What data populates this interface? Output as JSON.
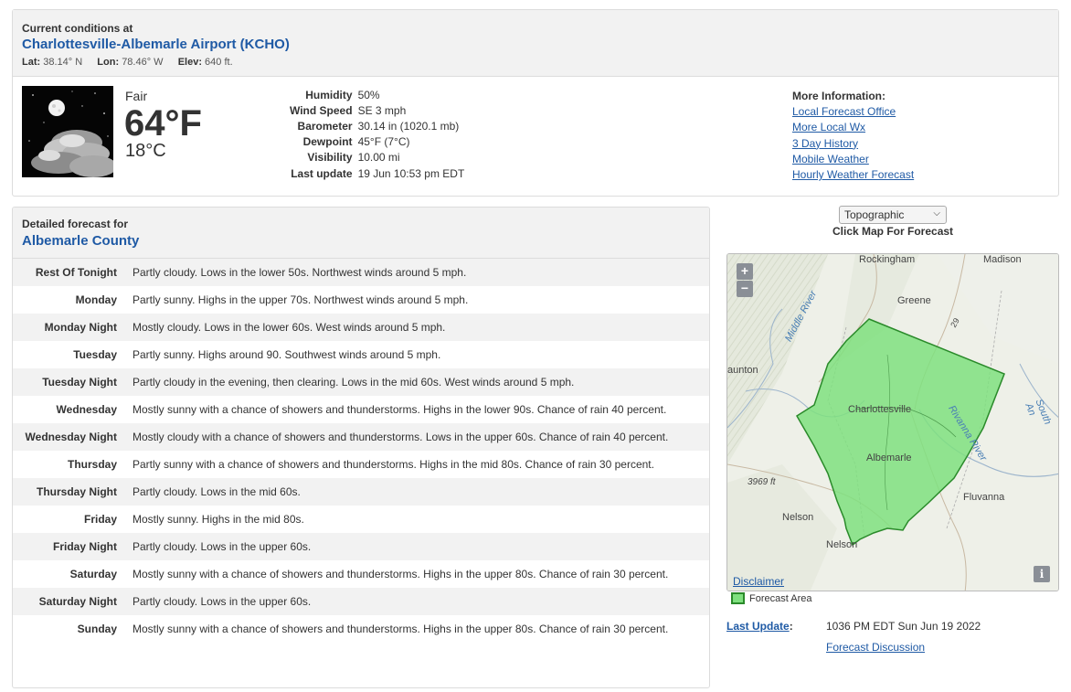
{
  "current": {
    "heading": "Current conditions at",
    "station": "Charlottesville-Albemarle Airport (KCHO)",
    "lat_label": "Lat:",
    "lat": "38.14° N",
    "lon_label": "Lon:",
    "lon": "78.46° W",
    "elev_label": "Elev:",
    "elev": "640 ft.",
    "condition": "Fair",
    "temp_f": "64°F",
    "temp_c": "18°C",
    "icon": "night-fair-moon-clouds-icon",
    "details": [
      {
        "label": "Humidity",
        "value": "50%"
      },
      {
        "label": "Wind Speed",
        "value": "SE 3 mph"
      },
      {
        "label": "Barometer",
        "value": "30.14 in (1020.1 mb)"
      },
      {
        "label": "Dewpoint",
        "value": "45°F (7°C)"
      },
      {
        "label": "Visibility",
        "value": "10.00 mi"
      },
      {
        "label": "Last update",
        "value": "19 Jun 10:53 pm EDT"
      }
    ],
    "more_info": {
      "title": "More Information:",
      "links": [
        "Local Forecast Office",
        "More Local Wx",
        "3 Day History",
        "Mobile Weather",
        "Hourly Weather Forecast"
      ]
    }
  },
  "forecast": {
    "heading": "Detailed forecast for",
    "area": "Albemarle County",
    "periods": [
      {
        "name": "Rest Of Tonight",
        "text": "Partly cloudy. Lows in the lower 50s. Northwest winds around 5 mph."
      },
      {
        "name": "Monday",
        "text": "Partly sunny. Highs in the upper 70s. Northwest winds around 5 mph."
      },
      {
        "name": "Monday Night",
        "text": "Mostly cloudy. Lows in the lower 60s. West winds around 5 mph."
      },
      {
        "name": "Tuesday",
        "text": "Partly sunny. Highs around 90. Southwest winds around 5 mph."
      },
      {
        "name": "Tuesday Night",
        "text": "Partly cloudy in the evening, then clearing. Lows in the mid 60s. West winds around 5 mph."
      },
      {
        "name": "Wednesday",
        "text": "Mostly sunny with a chance of showers and thunderstorms. Highs in the lower 90s. Chance of rain 40 percent."
      },
      {
        "name": "Wednesday Night",
        "text": "Mostly cloudy with a chance of showers and thunderstorms. Lows in the upper 60s. Chance of rain 40 percent."
      },
      {
        "name": "Thursday",
        "text": "Partly sunny with a chance of showers and thunderstorms. Highs in the mid 80s. Chance of rain 30 percent."
      },
      {
        "name": "Thursday Night",
        "text": "Partly cloudy. Lows in the mid 60s."
      },
      {
        "name": "Friday",
        "text": "Mostly sunny. Highs in the mid 80s."
      },
      {
        "name": "Friday Night",
        "text": "Partly cloudy. Lows in the upper 60s."
      },
      {
        "name": "Saturday",
        "text": "Mostly sunny with a chance of showers and thunderstorms. Highs in the upper 80s. Chance of rain 30 percent."
      },
      {
        "name": "Saturday Night",
        "text": "Partly cloudy. Lows in the upper 60s."
      },
      {
        "name": "Sunday",
        "text": "Mostly sunny with a chance of showers and thunderstorms. Highs in the upper 80s. Chance of rain 30 percent."
      }
    ]
  },
  "map": {
    "select_value": "Topographic",
    "caption": "Click Map For Forecast",
    "zoom_in": "+",
    "zoom_out": "−",
    "disclaimer": "Disclaimer",
    "info": "i",
    "places": {
      "rockingham": "Rockingham",
      "madison": "Madison",
      "greene": "Greene",
      "middle_river": "Middle River",
      "staunton": "aunton",
      "charlottesville": "Charlottesville",
      "albemarle": "Albemarle",
      "rivanna": "Rivanna River",
      "south_anna": "South An",
      "elevation": "3969 ft",
      "fluvanna": "Fluvanna",
      "nelson1": "Nelson",
      "nelson2": "Nelson",
      "route29": "29"
    },
    "legend": "Forecast Area",
    "forecast_area_color": "#7fe07f"
  },
  "footer": {
    "last_update_label": "Last Update",
    "last_update_colon": ":",
    "last_update_value": "1036 PM EDT Sun Jun 19 2022",
    "discussion": "Forecast Discussion"
  }
}
